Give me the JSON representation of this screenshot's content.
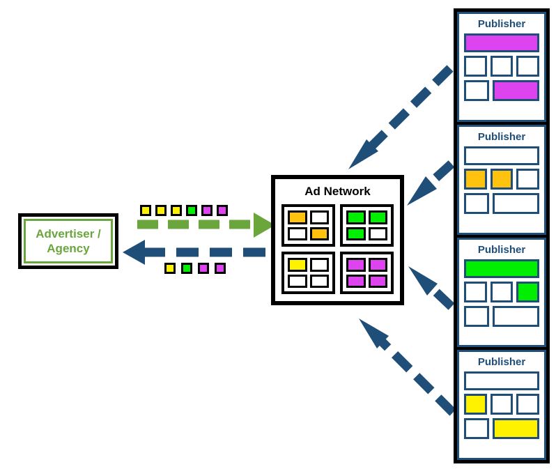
{
  "diagram": {
    "title": "Ad Network distribution diagram",
    "background": "#ffffff"
  },
  "colors": {
    "green_arrow": "#6AA63C",
    "blue_arrow": "#1F4E79",
    "publisher_border": "#1F4E79",
    "publisher_text": "#1F4E79",
    "advertiser_text": "#6AA63C",
    "black": "#000000",
    "white": "#ffffff",
    "yellow": "#FFF200",
    "orange": "#FFC20E",
    "green": "#00EE00",
    "magenta": "#DD44F0"
  },
  "advertiser": {
    "label": "Advertiser /\nAgency",
    "border_color": "#6AA63C",
    "outer_border_color": "#000000"
  },
  "ad_network": {
    "title": "Ad Network",
    "quadrants": [
      {
        "name": "quadrant-top-left",
        "cells": [
          "#FFC20E",
          "#ffffff",
          "#ffffff",
          "#FFC20E"
        ]
      },
      {
        "name": "quadrant-top-right",
        "cells": [
          "#00EE00",
          "#00EE00",
          "#00EE00",
          "#ffffff"
        ]
      },
      {
        "name": "quadrant-bottom-left",
        "cells": [
          "#FFF200",
          "#ffffff",
          "#ffffff",
          "#ffffff"
        ]
      },
      {
        "name": "quadrant-bottom-right",
        "cells": [
          "#DD44F0",
          "#DD44F0",
          "#DD44F0",
          "#DD44F0"
        ]
      }
    ]
  },
  "flows": {
    "outbound": {
      "name": "advertiser-to-network-flow",
      "direction": "right",
      "color": "#6AA63C",
      "packets": [
        "#FFF200",
        "#FFF200",
        "#FFF200",
        "#00EE00",
        "#DD44F0",
        "#DD44F0"
      ]
    },
    "inbound": {
      "name": "network-to-advertiser-flow",
      "direction": "left",
      "color": "#1F4E79",
      "packets": [
        "#FFF200",
        "#00EE00",
        "#DD44F0",
        "#DD44F0"
      ]
    },
    "publisher_arrows": [
      {
        "name": "publisher-1-arrow",
        "color": "#1F4E79",
        "from_publisher": 1
      },
      {
        "name": "publisher-2-arrow",
        "color": "#1F4E79",
        "from_publisher": 2
      },
      {
        "name": "publisher-3-arrow",
        "color": "#1F4E79",
        "from_publisher": 3
      },
      {
        "name": "publisher-4-arrow",
        "color": "#1F4E79",
        "from_publisher": 4
      }
    ]
  },
  "publishers": [
    {
      "title": "Publisher",
      "banner": "#DD44F0",
      "row_three": [
        "#ffffff",
        "#ffffff",
        "#ffffff"
      ],
      "row_two": [
        "#ffffff",
        "#DD44F0"
      ]
    },
    {
      "title": "Publisher",
      "banner": "#ffffff",
      "row_three": [
        "#FFC20E",
        "#FFC20E",
        "#ffffff"
      ],
      "row_two": [
        "#ffffff",
        "#ffffff"
      ]
    },
    {
      "title": "Publisher",
      "banner": "#00EE00",
      "row_three": [
        "#ffffff",
        "#ffffff",
        "#00EE00"
      ],
      "row_two": [
        "#ffffff",
        "#ffffff"
      ]
    },
    {
      "title": "Publisher",
      "banner": "#ffffff",
      "row_three": [
        "#FFF200",
        "#ffffff",
        "#ffffff"
      ],
      "row_two": [
        "#ffffff",
        "#FFF200"
      ]
    }
  ]
}
